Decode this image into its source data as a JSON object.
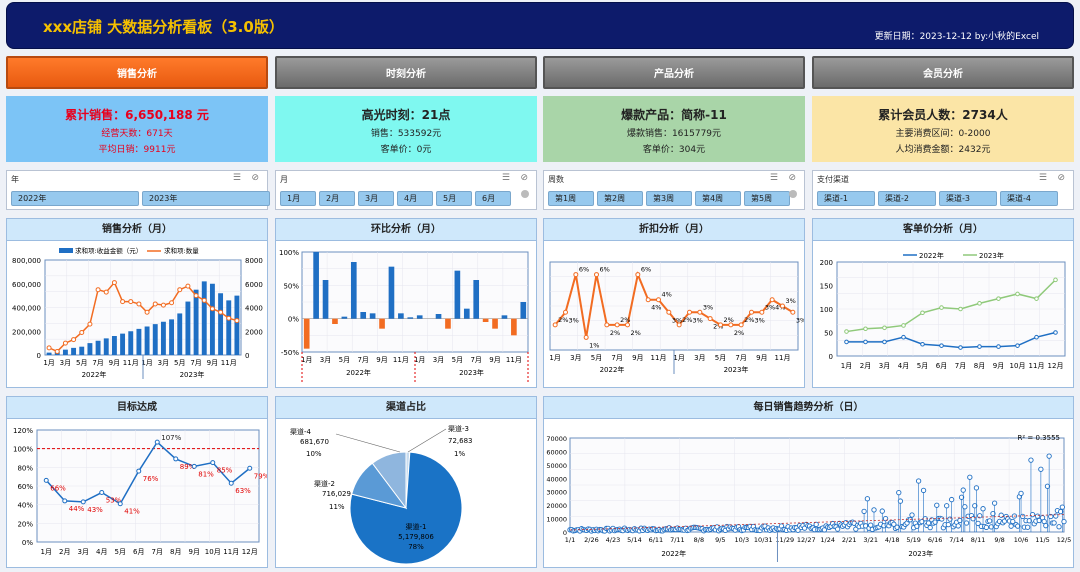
{
  "header": {
    "title": "xxx店铺  大数据分析看板（3.0版）",
    "date": "更新日期：2023-12-12 by:小秋的Excel"
  },
  "tabs": [
    {
      "label": "销售分析"
    },
    {
      "label": "时刻分析"
    },
    {
      "label": "产品分析"
    },
    {
      "label": "会员分析"
    }
  ],
  "kpis": [
    {
      "main": "累计销售：6,650,188 元",
      "sub1": "经营天数：671天",
      "sub2": "平均日销：9911元",
      "bg": "#7cc4f6",
      "color": "#e8001c"
    },
    {
      "main": "高光时刻：21点",
      "sub1": "销售：533592元",
      "sub2": "客单价：0元",
      "bg": "#7ff8f0",
      "color": "#222"
    },
    {
      "main": "爆款产品：简称-11",
      "sub1": "爆款销售：1615779元",
      "sub2": "客单价：304元",
      "bg": "#a9d5a8",
      "color": "#222"
    },
    {
      "main": "累计会员人数：2734人",
      "sub1": "主要消费区间：0-2000",
      "sub2": "人均消费金额：2432元",
      "bg": "#fbe5a6",
      "color": "#222"
    }
  ],
  "slicers": [
    {
      "caption": "年",
      "items": [
        "2022年",
        "2023年"
      ]
    },
    {
      "caption": "月",
      "items": [
        "1月",
        "2月",
        "3月",
        "4月",
        "5月",
        "6月"
      ]
    },
    {
      "caption": "周数",
      "items": [
        "第1周",
        "第2周",
        "第3周",
        "第4周",
        "第5周"
      ]
    },
    {
      "caption": "支付渠道",
      "items": [
        "渠道-1",
        "渠道-2",
        "渠道-3",
        "渠道-4"
      ]
    }
  ],
  "panels": {
    "sales": "销售分析（月）",
    "mom": "环比分析（月）",
    "discount": "折扣分析（月）",
    "aov": "客单价分析（月）",
    "target": "目标达成",
    "channel": "渠道占比",
    "daily": "每日销售趋势分析（日）"
  },
  "colors": {
    "blue": "#1f6fc4",
    "orange": "#f26c22",
    "green": "#8fc97a",
    "red": "#e00000"
  },
  "chart_data": [
    {
      "id": "sales",
      "type": "bar+line",
      "title": "销售分析（月）",
      "categories": [
        "1月",
        "3月",
        "5月",
        "7月",
        "9月",
        "11月",
        "1月",
        "3月",
        "5月",
        "7月",
        "9月",
        "11月"
      ],
      "x": [
        "2022-01",
        "2022-02",
        "2022-03",
        "2022-04",
        "2022-05",
        "2022-06",
        "2022-07",
        "2022-08",
        "2022-09",
        "2022-10",
        "2022-11",
        "2022-12",
        "2023-01",
        "2023-02",
        "2023-03",
        "2023-04",
        "2023-05",
        "2023-06",
        "2023-07",
        "2023-08",
        "2023-09",
        "2023-10",
        "2023-11",
        "2023-12"
      ],
      "groups": [
        "2022年",
        "2023年"
      ],
      "series": [
        {
          "name": "求和项:收益金额（元）",
          "axis": "left",
          "type": "bar",
          "values": [
            20000,
            30000,
            45000,
            60000,
            70000,
            100000,
            120000,
            140000,
            160000,
            180000,
            200000,
            220000,
            240000,
            260000,
            280000,
            300000,
            350000,
            450000,
            550000,
            620000,
            600000,
            520000,
            460000,
            500000
          ]
        },
        {
          "name": "求和项:数量",
          "axis": "right",
          "type": "line",
          "values": [
            600,
            300,
            1000,
            1300,
            1900,
            2600,
            5500,
            5300,
            6100,
            4500,
            4500,
            4300,
            3600,
            4300,
            4200,
            4400,
            5500,
            5800,
            5000,
            4600,
            3900,
            3600,
            3100,
            2900
          ]
        }
      ],
      "ylim_left": [
        0,
        800000
      ],
      "yticks_left": [
        "0",
        "200,000",
        "400,000",
        "600,000",
        "800,000"
      ],
      "ylim_right": [
        0,
        8000
      ],
      "yticks_right": [
        "0",
        "2000",
        "4000",
        "6000",
        "8000"
      ]
    },
    {
      "id": "mom",
      "type": "bar",
      "title": "环比分析（月）",
      "categories": [
        "1月",
        "3月",
        "5月",
        "7月",
        "9月",
        "11月",
        "1月",
        "3月",
        "5月",
        "7月",
        "9月",
        "11月"
      ],
      "groups": [
        "2022年",
        "2023年"
      ],
      "values": [
        -0.45,
        1.0,
        0.58,
        -0.08,
        0.03,
        0.85,
        0.1,
        0.08,
        -0.15,
        0.78,
        0.08,
        0.02,
        0.05,
        0.0,
        0.07,
        -0.15,
        0.72,
        0.15,
        0.58,
        -0.05,
        -0.15,
        0.05,
        -0.25,
        0.25
      ],
      "ylim": [
        -0.5,
        1.0
      ],
      "yticks": [
        "-50%",
        "0%",
        "50%",
        "100%"
      ]
    },
    {
      "id": "discount",
      "type": "line",
      "title": "折扣分析（月）",
      "categories": [
        "1月",
        "3月",
        "5月",
        "7月",
        "9月",
        "11月",
        "1月",
        "3月",
        "5月",
        "7月",
        "9月",
        "11月"
      ],
      "groups": [
        "2022年",
        "2023年"
      ],
      "values": [
        0.02,
        0.03,
        0.06,
        0.01,
        0.06,
        0.02,
        0.02,
        0.02,
        0.06,
        0.04,
        0.04,
        0.03,
        0.02,
        0.03,
        0.03,
        0.025,
        0.02,
        0.02,
        0.02,
        0.03,
        0.03,
        0.04,
        0.035,
        0.03
      ],
      "labels": [
        "2%",
        "3%",
        "6%",
        "1%",
        "6%",
        "2%",
        "2%",
        "2%",
        "6%",
        "4%",
        "4%",
        "3%",
        "2%",
        "3%",
        "3%",
        "2%",
        "2%",
        "2%",
        "2%",
        "3%",
        "3%",
        "4%",
        "3%",
        "3%"
      ],
      "ylim": [
        0,
        0.07
      ]
    },
    {
      "id": "aov",
      "type": "line",
      "title": "客单价分析（月）",
      "categories": [
        "1月",
        "2月",
        "3月",
        "4月",
        "5月",
        "6月",
        "7月",
        "8月",
        "9月",
        "10月",
        "11月",
        "12月"
      ],
      "series": [
        {
          "name": "2022年",
          "values": [
            30,
            30,
            30,
            40,
            25,
            22,
            18,
            20,
            20,
            22,
            40,
            50
          ]
        },
        {
          "name": "2023年",
          "values": [
            52,
            58,
            60,
            65,
            92,
            103,
            100,
            112,
            122,
            132,
            122,
            162
          ]
        }
      ],
      "ylim": [
        0,
        200
      ],
      "yticks": [
        "0",
        "50",
        "100",
        "150",
        "200"
      ]
    },
    {
      "id": "target",
      "type": "line",
      "title": "目标达成",
      "categories": [
        "1月",
        "2月",
        "3月",
        "4月",
        "5月",
        "6月",
        "7月",
        "8月",
        "9月",
        "10月",
        "11月",
        "12月"
      ],
      "values": [
        0.66,
        0.44,
        0.43,
        0.53,
        0.41,
        0.76,
        1.07,
        0.89,
        0.81,
        0.85,
        0.63,
        0.79
      ],
      "labels": [
        "66%",
        "44%",
        "43%",
        "53%",
        "41%",
        "76%",
        "107%",
        "89%",
        "81%",
        "85%",
        "63%",
        "79%"
      ],
      "target": 1.0,
      "ylim": [
        0,
        1.2
      ],
      "yticks": [
        "0%",
        "20%",
        "40%",
        "60%",
        "80%",
        "100%",
        "120%"
      ]
    },
    {
      "id": "channel",
      "type": "pie",
      "title": "渠道占比",
      "slices": [
        {
          "name": "渠道-1",
          "value": 5179806,
          "value_label": "5,179,806",
          "pct": "78%",
          "color": "#1a73c6"
        },
        {
          "name": "渠道-2",
          "value": 716029,
          "value_label": "716,029",
          "pct": "11%",
          "color": "#5a9ad6"
        },
        {
          "name": "渠道-4",
          "value": 681670,
          "value_label": "681,670",
          "pct": "10%",
          "color": "#8fb6de"
        },
        {
          "name": "渠道-3",
          "value": 72683,
          "value_label": "72,683",
          "pct": "1%",
          "color": "#c8dcef"
        }
      ]
    },
    {
      "id": "daily",
      "type": "scatter",
      "title": "每日销售趋势分析（日）",
      "xticks": [
        "1/1",
        "2/26",
        "4/23",
        "5/14",
        "6/11",
        "7/11",
        "8/8",
        "9/5",
        "10/3",
        "10/31",
        "11/29",
        "12/27",
        "1/24",
        "2/21",
        "3/21",
        "4/18",
        "5/19",
        "6/16",
        "7/14",
        "8/11",
        "9/8",
        "10/6",
        "11/5",
        "12/5"
      ],
      "groups": [
        "2022年",
        "2023年"
      ],
      "ylim": [
        0,
        70000
      ],
      "yticks": [
        "0",
        "10000",
        "20000",
        "30000",
        "40000",
        "50000",
        "60000",
        "70000"
      ],
      "r2": "R² = 0.3555"
    }
  ]
}
